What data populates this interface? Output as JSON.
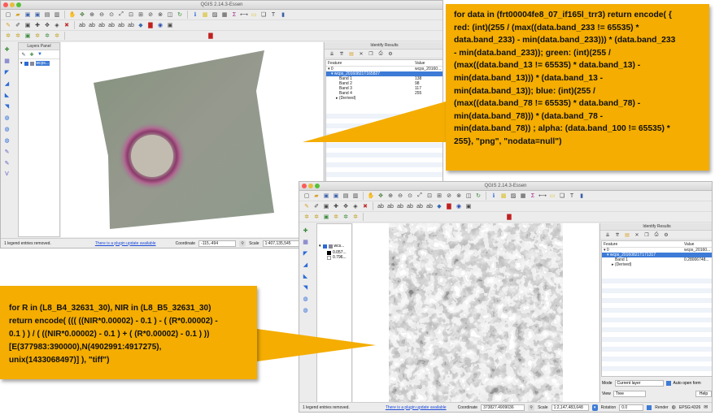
{
  "window1": {
    "title": "QGIS 2.14.3-Essen",
    "layers_panel": {
      "title": "Layers Panel",
      "layer_name": "wcps..."
    },
    "identify": {
      "title": "Identify Results",
      "col_feature": "Feature",
      "col_value": "Value",
      "rows": [
        {
          "k": "▾ 0",
          "v": "wcps_20160...",
          "sel": false,
          "indent": 0
        },
        {
          "k": "▾ wcps_20160821T165827",
          "v": "",
          "sel": true,
          "indent": 4
        },
        {
          "k": "Band 1",
          "v": "138",
          "sel": false,
          "indent": 14
        },
        {
          "k": "Band 2",
          "v": "98",
          "sel": false,
          "indent": 14
        },
        {
          "k": "Band 3",
          "v": "117",
          "sel": false,
          "indent": 14
        },
        {
          "k": "Band 4",
          "v": "255",
          "sel": false,
          "indent": 14
        },
        {
          "k": "▸ (Derived)",
          "v": "",
          "sel": false,
          "indent": 10
        }
      ]
    },
    "status": {
      "legend_msg": "1 legend entries removed.",
      "plugin_link": "There is a plugin update available",
      "coordinate_label": "Coordinate",
      "coordinate_value": "-115,-494",
      "scale_label": "Scale",
      "scale_value": "1:407,135,545"
    }
  },
  "window2": {
    "title": "QGIS 2.14.3-Essen",
    "layers_panel": {
      "layer_name": "wcs...",
      "legend_vals": [
        "0.057...",
        "0.796..."
      ]
    },
    "identify": {
      "title": "Identify Results",
      "col_feature": "Feature",
      "col_value": "Value",
      "rows": [
        {
          "k": "▾ 0",
          "v": "wcps_20160...",
          "sel": false,
          "indent": 0
        },
        {
          "k": "▾ wcps_20160821T171317",
          "v": "",
          "sel": true,
          "indent": 4
        },
        {
          "k": "Band 1",
          "v": "0.28006748...",
          "sel": false,
          "indent": 14
        },
        {
          "k": "▸ (Derived)",
          "v": "",
          "sel": false,
          "indent": 10
        }
      ],
      "mode_label": "Mode",
      "mode_value": "Current layer",
      "auto_open": "Auto open form",
      "view_label": "View",
      "view_value": "Tree",
      "help_label": "Help"
    },
    "status": {
      "legend_msg": "1 legend entries removed.",
      "plugin_link": "There is a plugin update available",
      "coordinate_label": "Coordinate",
      "coordinate_value": "373827.4909036",
      "scale_label": "Scale",
      "scale_value": "1:2,147,483,648",
      "rotation_label": "Rotation",
      "rotation_value": "0.0",
      "render_label": "Render",
      "epsg_label": "EPSG:4326"
    }
  },
  "callout_top": {
    "lines": [
      "for data in (frt00004fe8_07_if165l_trr3)  return encode( {",
      "red: (int)(255 / (max((data.band_233 != 65535)  *",
      "data.band_233)  - min(data.band_233)))  * (data.band_233",
      "- min(data.band_233));  green:  (int)(255 /",
      "(max((data.band_13 != 65535) * data.band_13)  -",
      "min(data.band_13)))  * (data.band_13  -",
      "min(data.band_13));  blue: (int)(255 /",
      "(max((data.band_78 != 65535) * data.band_78)  -",
      "min(data.band_78)))  * (data.band_78  -",
      "min(data.band_78))  ; alpha: (data.band_100 != 65535)  *",
      "255}, \"png\", \"nodata=null\")"
    ]
  },
  "callout_bottom": {
    "lines": [
      "for R in (L8_B4_32631_30),  NIR in (L8_B5_32631_30)",
      "return encode( ((( ((NIR*0.00002)  - 0.1  ) - ( (R*0.00002)  -",
      "0.1 ) ) / ( ((NIR*0.00002)   - 0.1 ) + ( (R*0.00002)   - 0.1 ) ))",
      "[E(377983:390000),N(4902991:4917275),",
      "unix(1433068497)]  ), \"tiff\")"
    ]
  },
  "colors": {
    "callout": "#f4ad00",
    "selection": "#3d7bd6",
    "link": "#1a49d8"
  }
}
